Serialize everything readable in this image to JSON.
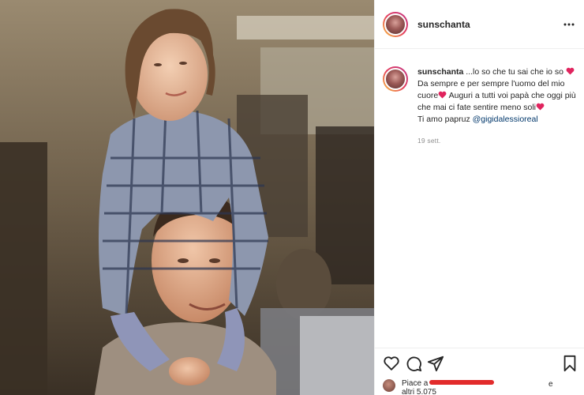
{
  "post": {
    "username": "sunschanta",
    "more_icon": "more-horizontal-icon"
  },
  "caption": {
    "handle": "sunschanta",
    "line1": " ...lo so che tu sai che io so ",
    "line2": "Da sempre e per sempre l'uomo del mio cuore",
    "line3": " Auguri a tutti voi papà che oggi più che mai ci fate sentire meno soli",
    "line4_prefix": "Ti amo papruz ",
    "mention": "@gigidalessioreal",
    "timestamp": "19 sett."
  },
  "actions": {
    "icons": [
      "heart-icon",
      "comment-icon",
      "share-icon",
      "bookmark-icon"
    ]
  },
  "likes": {
    "prefix": "Piace a",
    "suffix": "e",
    "others": "altri 5.075"
  },
  "colors": {
    "heart": "#e0245e",
    "mention": "#00376b",
    "muted": "#8e8e8e",
    "redaction": "#e22b2b"
  }
}
